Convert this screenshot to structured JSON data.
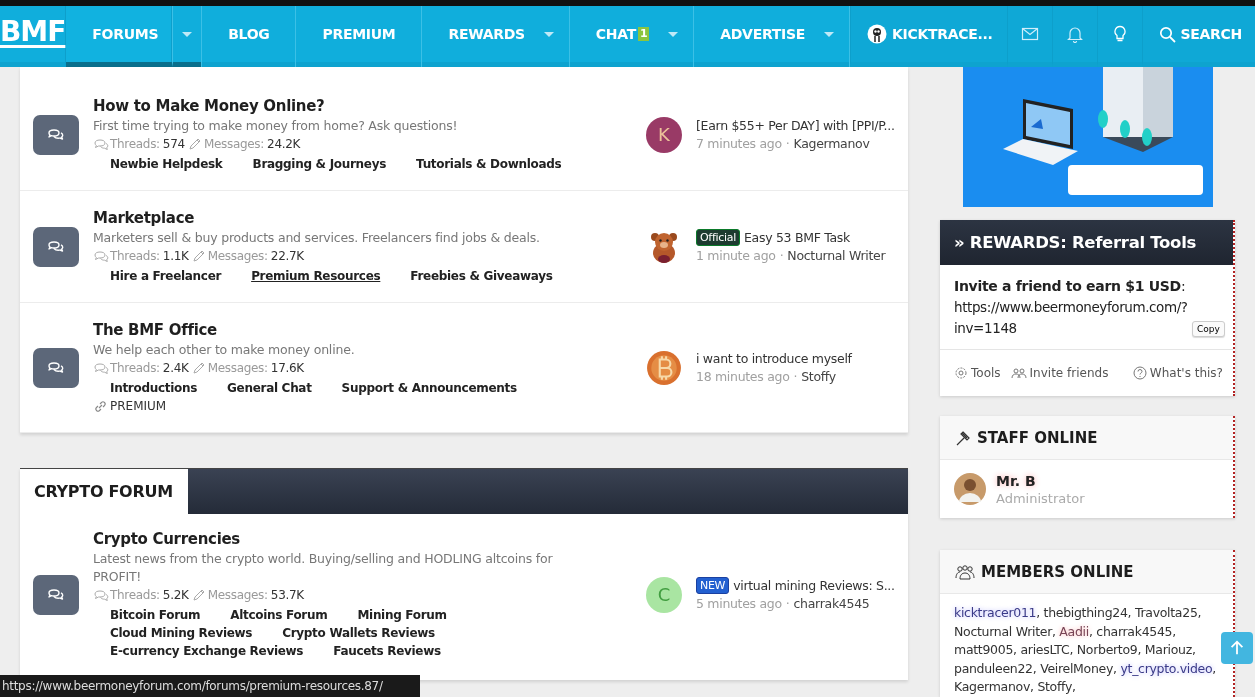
{
  "top_nav": {
    "logo": "BMF",
    "items": [
      {
        "label": "FORUMS",
        "selected": true,
        "dropdown": true,
        "split": true
      },
      {
        "label": "BLOG",
        "selected": false,
        "dropdown": false,
        "split": false
      },
      {
        "label": "PREMIUM",
        "selected": false,
        "dropdown": false,
        "split": false
      },
      {
        "label": "REWARDS",
        "selected": false,
        "dropdown": true,
        "split": false
      },
      {
        "label": "CHAT",
        "selected": false,
        "dropdown": true,
        "split": false,
        "badge": "1"
      },
      {
        "label": "ADVERTISE",
        "selected": false,
        "dropdown": true,
        "split": false
      }
    ],
    "user": {
      "name": "KICKTRACE..."
    },
    "search": {
      "label": "SEARCH"
    }
  },
  "forum_sections": [
    {
      "nodes": [
        {
          "title": "How to Make Money Online?",
          "description": "First time trying to make money from home? Ask questions!",
          "threads_label": "Threads:",
          "threads": "574",
          "messages_label": "Messages:",
          "messages": "24.2K",
          "subforums": [
            {
              "label": "Newbie Helpdesk",
              "hovered": false
            },
            {
              "label": "Bragging & Journeys",
              "hovered": false
            },
            {
              "label": "Tutorials & Downloads",
              "hovered": false
            }
          ],
          "latest": {
            "title": "[Earn $55+ Per DAY] with [PPI/P...",
            "time": "7 minutes ago",
            "separator": "·",
            "author": "Kagermanov",
            "avatar": {
              "kind": "letter",
              "letter": "K",
              "color": "#993a66"
            }
          }
        },
        {
          "title": "Marketplace",
          "description": "Marketers sell & buy products and services. Freelancers find jobs & deals.",
          "threads_label": "Threads:",
          "threads": "1.1K",
          "messages_label": "Messages:",
          "messages": "22.7K",
          "subforums": [
            {
              "label": "Hire a Freelancer",
              "hovered": false
            },
            {
              "label": "Premium Resources",
              "hovered": true
            },
            {
              "label": "Freebies & Giveaways",
              "hovered": false
            }
          ],
          "latest": {
            "prefix": {
              "text": "Official",
              "kind": "official"
            },
            "title": "Easy 53 BMF Task",
            "time": "1 minute ago",
            "separator": "·",
            "author": "Nocturnal Writer",
            "avatar": {
              "kind": "bear"
            }
          }
        },
        {
          "title": "The BMF Office",
          "description": "We help each other to make money online.",
          "threads_label": "Threads:",
          "threads": "2.4K",
          "messages_label": "Messages:",
          "messages": "17.6K",
          "subforums": [
            {
              "label": "Introductions",
              "hovered": false
            },
            {
              "label": "General Chat",
              "hovered": false
            },
            {
              "label": "Support & Announcements",
              "hovered": false
            }
          ],
          "links": [
            {
              "label": "PREMIUM"
            }
          ],
          "latest": {
            "title": "i want to introduce myself",
            "time": "18 minutes ago",
            "separator": "·",
            "author": "Stoffy",
            "avatar": {
              "kind": "coin"
            }
          }
        }
      ]
    },
    {
      "title": "CRYPTO FORUM",
      "nodes": [
        {
          "title": "Crypto Currencies",
          "description": "Latest news from the crypto world. Buying/selling and HODLING altcoins for PROFIT!",
          "threads_label": "Threads:",
          "threads": "5.2K",
          "messages_label": "Messages:",
          "messages": "53.7K",
          "subforums": [
            {
              "label": "Bitcoin Forum",
              "hovered": false
            },
            {
              "label": "Altcoins Forum",
              "hovered": false
            },
            {
              "label": "Mining Forum",
              "hovered": false
            },
            {
              "label": "Cloud Mining Reviews",
              "hovered": false
            },
            {
              "label": "Crypto Wallets Reviews",
              "hovered": false
            },
            {
              "label": "E-currency Exchange Reviews",
              "hovered": false
            },
            {
              "label": "Faucets Reviews",
              "hovered": false
            }
          ],
          "latest": {
            "prefix": {
              "text": "NEW",
              "kind": "new"
            },
            "title": "virtual mining Reviews: S...",
            "time": "5 minutes ago",
            "separator": "·",
            "author": "charrak4545",
            "avatar": {
              "kind": "letter",
              "letter": "C",
              "color": "#a9e5a2"
            }
          }
        }
      ]
    }
  ],
  "sidebar": {
    "rewards": {
      "title": "» REWARDS: Referral Tools",
      "invite": "**Invite a friend to earn $1 USD**:",
      "link": "https://www.beermoneyforum.com/?inv=1148",
      "copy_button": "Copy",
      "footer": [
        {
          "label": "Tools"
        },
        {
          "label": "Invite friends"
        },
        {
          "label": "What's this?"
        }
      ]
    },
    "staff_online": {
      "title": "STAFF ONLINE",
      "members": [
        {
          "name": "Mr. B",
          "role": "Administrator"
        }
      ]
    },
    "members_online": {
      "title": "MEMBERS ONLINE",
      "separator": ",",
      "members": [
        {
          "name": "kicktracer011",
          "kind": "self"
        },
        {
          "name": "thebigthing24",
          "kind": "member"
        },
        {
          "name": "Travolta25",
          "kind": "member"
        },
        {
          "name": "Nocturnal Writer",
          "kind": "member"
        },
        {
          "name": "Aadii",
          "kind": "staff"
        },
        {
          "name": "charrak4545",
          "kind": "member"
        },
        {
          "name": "matt9005",
          "kind": "member"
        },
        {
          "name": "ariesLTC",
          "kind": "member"
        },
        {
          "name": "Norberto9",
          "kind": "member"
        },
        {
          "name": "Mariouz",
          "kind": "member"
        },
        {
          "name": "panduleen22",
          "kind": "member"
        },
        {
          "name": "VeirelMoney",
          "kind": "member"
        },
        {
          "name": "yt_crypto.video",
          "kind": "self"
        },
        {
          "name": "Kagermanov",
          "kind": "member"
        },
        {
          "name": "Stoffy",
          "kind": "member"
        }
      ]
    }
  },
  "status_bar": {
    "url": "https://www.beermoneyforum.com/forums/premium-resources.87/"
  }
}
